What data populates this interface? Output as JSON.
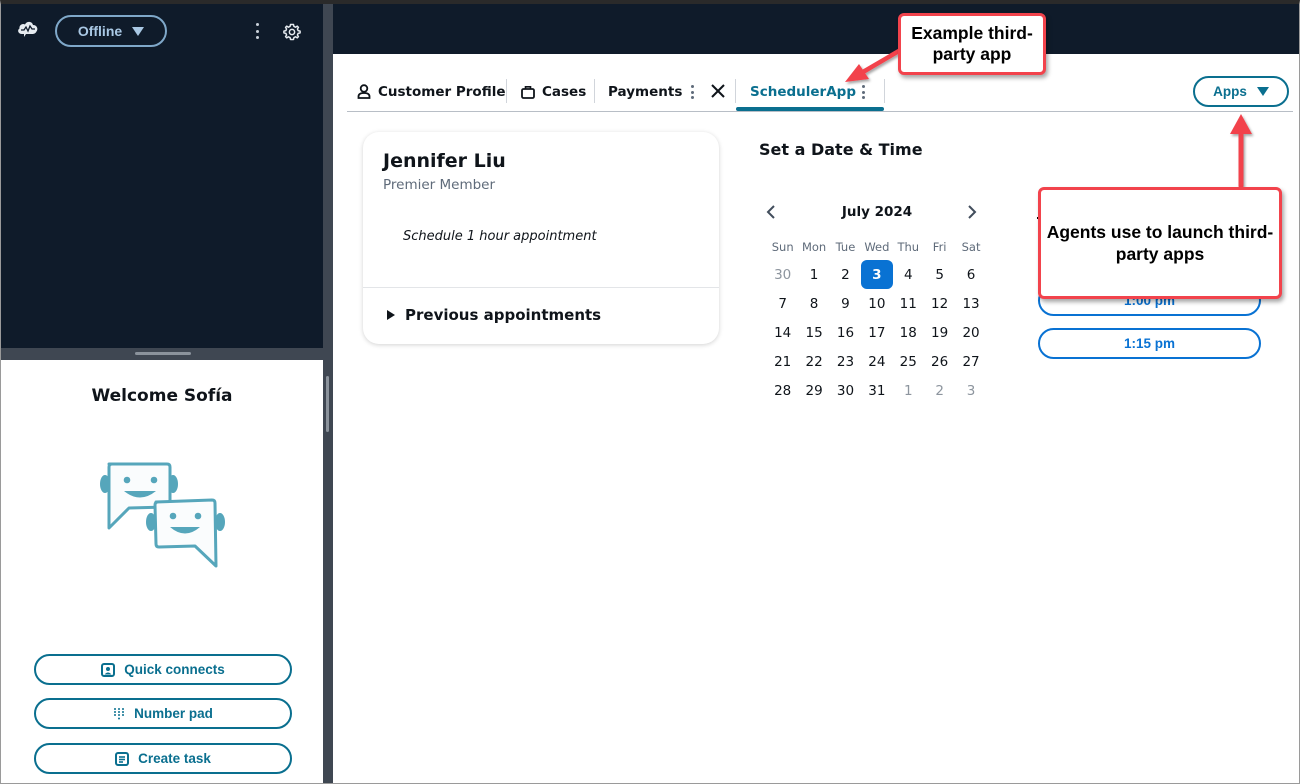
{
  "top_bar": {
    "app_icon": "cloud-pulse-icon",
    "status_label": "Offline",
    "more_icon": "kebab-icon",
    "settings_icon": "gear-icon"
  },
  "left_panel": {
    "welcome": "Welcome Sofía",
    "illustration": "chat-bubbles-smiley-icon",
    "actions": [
      {
        "label": "Quick connects",
        "icon": "contact-card-icon"
      },
      {
        "label": "Number pad",
        "icon": "dialpad-icon"
      },
      {
        "label": "Create task",
        "icon": "task-list-icon"
      }
    ]
  },
  "tabs": [
    {
      "label": "Customer Profile",
      "icon": "user-icon",
      "active": false
    },
    {
      "label": "Cases",
      "icon": "briefcase-icon",
      "active": false
    },
    {
      "label": "Payments",
      "active": false
    },
    {
      "label": "SchedulerApp",
      "active": true
    }
  ],
  "apps_button": {
    "label": "Apps"
  },
  "customer_card": {
    "name": "Jennifer Liu",
    "tier": "Premier Member",
    "note": "Schedule 1 hour appointment",
    "expand_label": "Previous appointments"
  },
  "scheduler": {
    "title": "Set a Date & Time",
    "month_label": "July 2024",
    "weekdays": [
      "Sun",
      "Mon",
      "Tue",
      "Wed",
      "Thu",
      "Fri",
      "Sat"
    ],
    "weeks": [
      [
        {
          "d": "30",
          "muted": true
        },
        {
          "d": "1"
        },
        {
          "d": "2"
        },
        {
          "d": "3",
          "selected": true
        },
        {
          "d": "4"
        },
        {
          "d": "5"
        },
        {
          "d": "6"
        }
      ],
      [
        {
          "d": "7"
        },
        {
          "d": "8"
        },
        {
          "d": "9"
        },
        {
          "d": "10"
        },
        {
          "d": "11"
        },
        {
          "d": "12"
        },
        {
          "d": "13"
        }
      ],
      [
        {
          "d": "14"
        },
        {
          "d": "15"
        },
        {
          "d": "16"
        },
        {
          "d": "17"
        },
        {
          "d": "18"
        },
        {
          "d": "19"
        },
        {
          "d": "20"
        }
      ],
      [
        {
          "d": "21"
        },
        {
          "d": "22"
        },
        {
          "d": "23"
        },
        {
          "d": "24"
        },
        {
          "d": "25"
        },
        {
          "d": "26"
        },
        {
          "d": "27"
        }
      ],
      [
        {
          "d": "28"
        },
        {
          "d": "29"
        },
        {
          "d": "30"
        },
        {
          "d": "31"
        },
        {
          "d": "1",
          "muted": true
        },
        {
          "d": "2",
          "muted": true
        },
        {
          "d": "3",
          "muted": true
        }
      ]
    ],
    "time_slots": [
      "1:00 pm",
      "1:15 pm"
    ]
  },
  "annotations": [
    {
      "text": "Example third-party app"
    },
    {
      "text": "Agents use to launch third-party apps"
    }
  ],
  "colors": {
    "header_bg": "#0f1b2a",
    "accent_teal": "#0a6f8f",
    "selected_blue": "#0972d3",
    "callout_red": "#f2434c"
  }
}
